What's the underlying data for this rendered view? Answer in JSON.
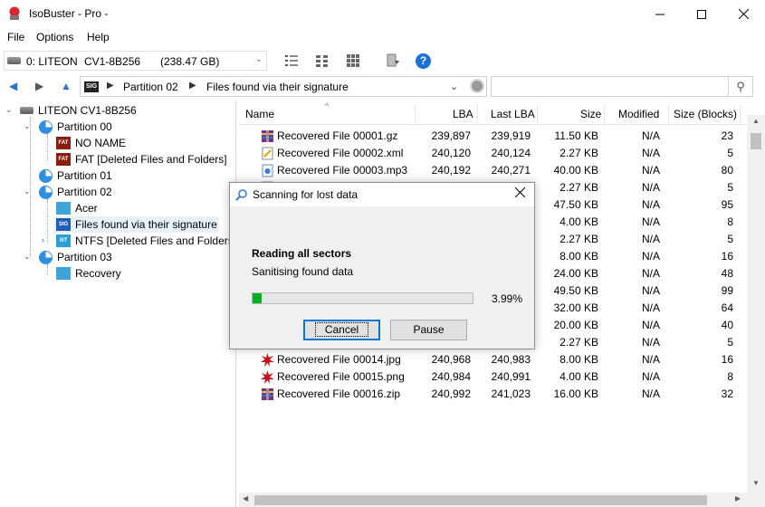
{
  "window": {
    "title": "IsoBuster - Pro -"
  },
  "menu": {
    "file": "File",
    "options": "Options",
    "help": "Help"
  },
  "drive": {
    "label": "0: LITEON",
    "model": "CV1-8B256",
    "size": "(238.47 GB)"
  },
  "address": {
    "sig_badge": "SIG",
    "crumbs": [
      "Partition 02",
      "Files found via their signature"
    ]
  },
  "tree": {
    "root": "LITEON CV1-8B256",
    "items": [
      "Partition 00",
      "NO NAME",
      "FAT [Deleted Files and Folders]",
      "Partition 01",
      "Partition 02",
      "Acer",
      "Files found via their signature",
      "NTFS [Deleted Files and Folders]",
      "Partition 03",
      "Recovery"
    ],
    "badges": {
      "fat": "FAT",
      "sig": "SIG",
      "ntfs": "NT"
    }
  },
  "columns": [
    "Name",
    "LBA",
    "Last LBA",
    "Size",
    "Modified",
    "Size (Blocks)"
  ],
  "rows": [
    {
      "name": "Recovered File 00001.gz",
      "lba": "239,897",
      "last": "239,919",
      "size": "11.50 KB",
      "mod": "N/A",
      "blocks": "23",
      "icon": "zip"
    },
    {
      "name": "Recovered File 00002.xml",
      "lba": "240,120",
      "last": "240,124",
      "size": "2.27 KB",
      "mod": "N/A",
      "blocks": "5",
      "icon": "xml"
    },
    {
      "name": "Recovered File 00003.mp3",
      "lba": "240,192",
      "last": "240,271",
      "size": "40.00 KB",
      "mod": "N/A",
      "blocks": "80",
      "icon": "mp3"
    },
    {
      "name": "",
      "lba": "",
      "last": "",
      "size": "2.27 KB",
      "mod": "N/A",
      "blocks": "5",
      "icon": "xml"
    },
    {
      "name": "",
      "lba": "",
      "last": "",
      "size": "47.50 KB",
      "mod": "N/A",
      "blocks": "95",
      "icon": ""
    },
    {
      "name": "",
      "lba": "",
      "last": "",
      "size": "4.00 KB",
      "mod": "N/A",
      "blocks": "8",
      "icon": ""
    },
    {
      "name": "",
      "lba": "",
      "last": "",
      "size": "2.27 KB",
      "mod": "N/A",
      "blocks": "5",
      "icon": ""
    },
    {
      "name": "",
      "lba": "",
      "last": "",
      "size": "8.00 KB",
      "mod": "N/A",
      "blocks": "16",
      "icon": ""
    },
    {
      "name": "",
      "lba": "",
      "last": "",
      "size": "24.00 KB",
      "mod": "N/A",
      "blocks": "48",
      "icon": ""
    },
    {
      "name": "",
      "lba": "",
      "last": "",
      "size": "49.50 KB",
      "mod": "N/A",
      "blocks": "99",
      "icon": ""
    },
    {
      "name": "",
      "lba": "",
      "last": "",
      "size": "32.00 KB",
      "mod": "N/A",
      "blocks": "64",
      "icon": ""
    },
    {
      "name": "",
      "lba": "",
      "last": "",
      "size": "20.00 KB",
      "mod": "N/A",
      "blocks": "40",
      "icon": ""
    },
    {
      "name": "",
      "lba": "",
      "last": "",
      "size": "2.27 KB",
      "mod": "N/A",
      "blocks": "5",
      "icon": ""
    },
    {
      "name": "Recovered File 00014.jpg",
      "lba": "240,968",
      "last": "240,983",
      "size": "8.00 KB",
      "mod": "N/A",
      "blocks": "16",
      "icon": "img"
    },
    {
      "name": "Recovered File 00015.png",
      "lba": "240,984",
      "last": "240,991",
      "size": "4.00 KB",
      "mod": "N/A",
      "blocks": "8",
      "icon": "img"
    },
    {
      "name": "Recovered File 00016.zip",
      "lba": "240,992",
      "last": "241,023",
      "size": "16.00 KB",
      "mod": "N/A",
      "blocks": "32",
      "icon": "zip"
    }
  ],
  "dialog": {
    "title": "Scanning for lost data",
    "heading": "Reading all sectors",
    "subtext": "Sanitising found data",
    "progress": 0.0399,
    "percent_text": "3.99%",
    "cancel": "Cancel",
    "pause": "Pause"
  },
  "colors": {
    "accent": "#0078d7",
    "progress": "#06b025",
    "selection": "#e5f1fb"
  }
}
